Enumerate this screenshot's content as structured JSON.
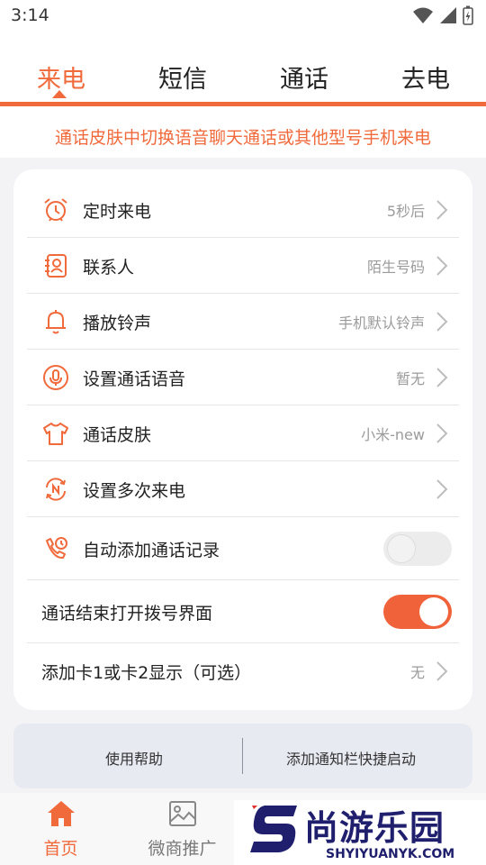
{
  "status_bar": {
    "time": "3:14"
  },
  "tabs": [
    {
      "label": "来电",
      "active": true
    },
    {
      "label": "短信",
      "active": false
    },
    {
      "label": "通话",
      "active": false
    },
    {
      "label": "去电",
      "active": false
    }
  ],
  "hint": "通话皮肤中切换语音聊天通话或其他型号手机来电",
  "settings": {
    "timed_call": {
      "label": "定时来电",
      "value": "5秒后",
      "icon": "alarm-clock-icon"
    },
    "contact": {
      "label": "联系人",
      "value": "陌生号码",
      "icon": "contact-icon"
    },
    "ringtone": {
      "label": "播放铃声",
      "value": "手机默认铃声",
      "icon": "bell-icon"
    },
    "voice": {
      "label": "设置通话语音",
      "value": "暂无",
      "icon": "microphone-icon"
    },
    "skin": {
      "label": "通话皮肤",
      "value": "小米-new",
      "icon": "tshirt-icon"
    },
    "repeat": {
      "label": "设置多次来电",
      "value": "",
      "icon": "repeat-icon"
    },
    "auto_record": {
      "label": "自动添加通话记录",
      "enabled": false,
      "icon": "phone-clock-icon"
    },
    "open_dialer": {
      "label": "通话结束打开拨号界面",
      "enabled": true
    },
    "sim_display": {
      "label": "添加卡1或卡2显示（可选）",
      "value": "无"
    }
  },
  "help_bar": {
    "help": "使用帮助",
    "notification": "添加通知栏快捷启动"
  },
  "bottom_nav": [
    {
      "label": "首页",
      "icon": "home-icon",
      "active": true
    },
    {
      "label": "微商推广",
      "icon": "image-icon",
      "active": false
    }
  ],
  "watermark": {
    "title": "尚游乐园",
    "url": "SHYIYUANYK.COM"
  },
  "colors": {
    "accent": "#f06a3c",
    "background": "#f3f3f6",
    "card": "#ffffff"
  }
}
